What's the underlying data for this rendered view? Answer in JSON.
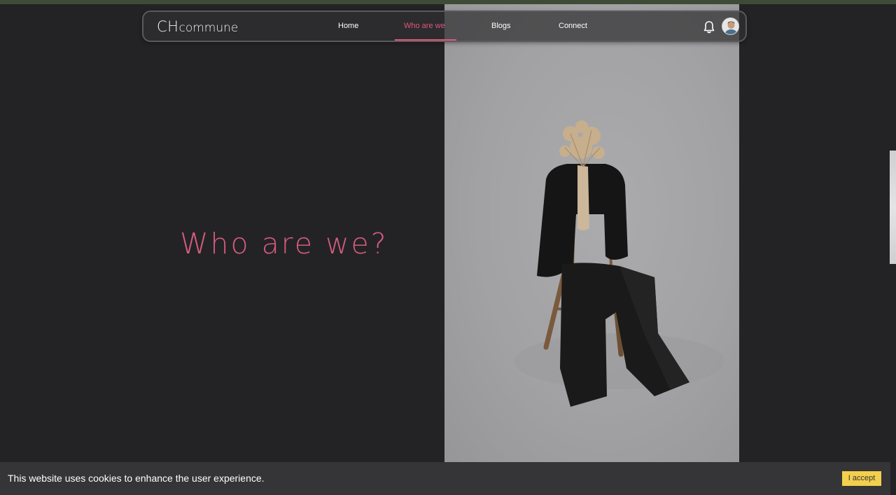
{
  "navbar": {
    "logo_big": "CH",
    "logo_small": "commune",
    "items": [
      {
        "label": "Home",
        "active": false
      },
      {
        "label": "Who are we",
        "active": true
      },
      {
        "label": "Blogs",
        "active": false
      },
      {
        "label": "Connect",
        "active": false
      }
    ],
    "icons": [
      "bell-icon",
      "user-avatar"
    ]
  },
  "hero": {
    "title": "Who are we?",
    "image": "photo-chair-with-black-suit-and-dried-flowers"
  },
  "cookie": {
    "text": "This website uses cookies to enhance the user experience.",
    "button_label": "I accept"
  },
  "colors": {
    "accent": "#e2557a",
    "background": "#232325",
    "cookie_bar": "#353537",
    "cookie_button": "#f3cf4e"
  }
}
